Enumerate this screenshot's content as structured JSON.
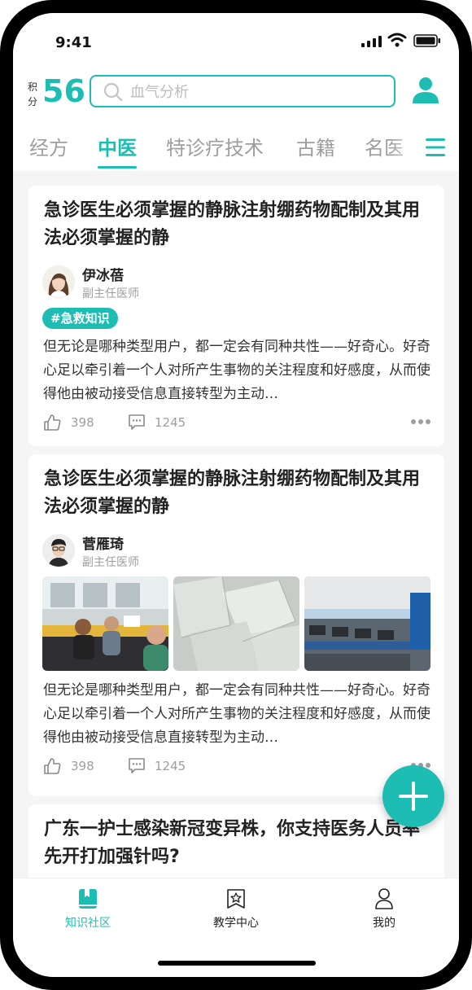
{
  "status_bar": {
    "time": "9:41"
  },
  "header": {
    "points_label": "积分",
    "points_value": "56",
    "search_placeholder": "血气分析"
  },
  "tabs": [
    {
      "label": "经方",
      "active": false
    },
    {
      "label": "中医",
      "active": true
    },
    {
      "label": "特诊疗技术",
      "active": false
    },
    {
      "label": "古籍",
      "active": false
    },
    {
      "label": "名医",
      "active": false
    }
  ],
  "posts": [
    {
      "title": "急诊医生必须掌握的静脉注射绷药物配制及其用法必须掌握的静",
      "author": "伊冰蓓",
      "role": "副主任医师",
      "tag": "#急救知识",
      "excerpt": "但无论是哪种类型用户，都一定会有同种共性——好奇心。好奇心足以牵引着一个人对所产生事物的关注程度和好感度，从而使得他由被动接受信息直接转型为主动…",
      "likes": "398",
      "comments": "1245"
    },
    {
      "title": "急诊医生必须掌握的静脉注射绷药物配制及其用法必须掌握的静",
      "author": "菅雁琦",
      "role": "副主任医师",
      "excerpt": "但无论是哪种类型用户，都一定会有同种共性——好奇心。好奇心足以牵引着一个人对所产生事物的关注程度和好感度，从而使得他由被动接受信息直接转型为主动…",
      "likes": "398",
      "comments": "1245",
      "images": [
        "office-meeting-photo",
        "paper-sheets-photo",
        "open-office-photo"
      ]
    },
    {
      "title": "广东一护士感染新冠变异株，你支持医务人员率先开打加强针吗?"
    }
  ],
  "bottom_nav": [
    {
      "label": "知识社区",
      "icon": "book-icon",
      "active": true
    },
    {
      "label": "教学中心",
      "icon": "badge-icon",
      "active": false
    },
    {
      "label": "我的",
      "icon": "person-icon",
      "active": false
    }
  ],
  "colors": {
    "accent": "#1dbdb3",
    "muted": "#9e9e9e",
    "text": "#222222",
    "background": "#f5f5f5"
  }
}
